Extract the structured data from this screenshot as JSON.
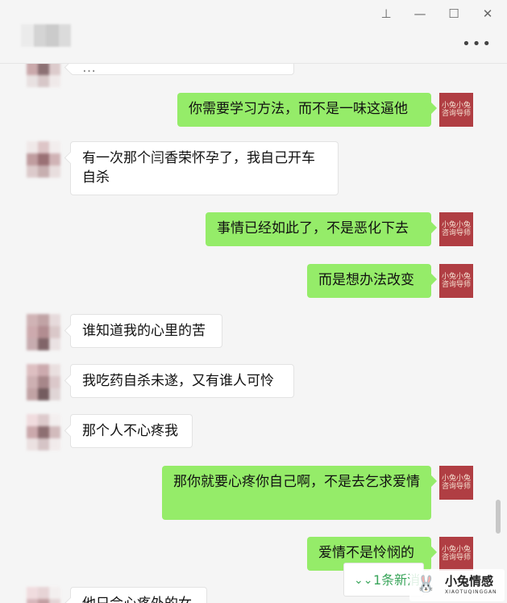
{
  "window": {
    "pin_icon": "pin-icon",
    "minimize_icon": "minimize-icon",
    "maximize_icon": "maximize-icon",
    "close_icon": "close-icon",
    "more_icon": "more-icon"
  },
  "self_avatar_text": "小兔小兔\n咨询导师",
  "messages": [
    {
      "side": "left",
      "text": "…"
    },
    {
      "side": "right",
      "text": "你需要学习方法，而不是一味这逼他"
    },
    {
      "side": "left",
      "text": "有一次那个闫香荣怀孕了，我自己开车自杀"
    },
    {
      "side": "right",
      "text": "事情已经如此了，不是恶化下去"
    },
    {
      "side": "right",
      "text": "而是想办法改变"
    },
    {
      "side": "left",
      "text": "谁知道我的心里的苦"
    },
    {
      "side": "left",
      "text": "我吃药自杀未遂，又有谁人可怜"
    },
    {
      "side": "left",
      "text": "那个人不心疼我"
    },
    {
      "side": "right",
      "text": "那你就要心疼你自己啊，不是去乞求爱情"
    },
    {
      "side": "right",
      "text": "爱情不是怜悯的"
    },
    {
      "side": "left",
      "text": "他只会心疼外的女"
    }
  ],
  "new_message_button": "1条新消息",
  "watermark": {
    "title": "小兔情感",
    "subtitle": "XIAOTUQINGGAN"
  },
  "colors": {
    "self_bubble": "#95ec69",
    "other_bubble": "#ffffff",
    "avatar_self": "#b03e43"
  }
}
